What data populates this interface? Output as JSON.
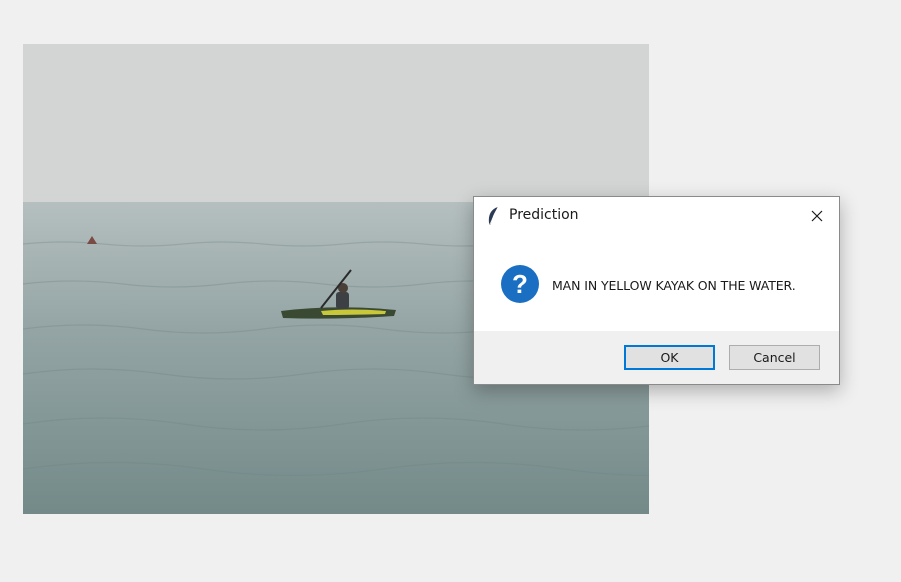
{
  "dialog": {
    "title": "Prediction",
    "message": "MAN IN YELLOW KAYAK ON THE WATER.",
    "ok_label": "OK",
    "cancel_label": "Cancel",
    "icons": {
      "title": "feather-icon",
      "message": "question-icon",
      "close": "close-icon"
    },
    "colors": {
      "focus_border": "#0078d7",
      "question_icon": "#1a6fc2"
    }
  },
  "photo": {
    "subject": "kayak-photo"
  }
}
